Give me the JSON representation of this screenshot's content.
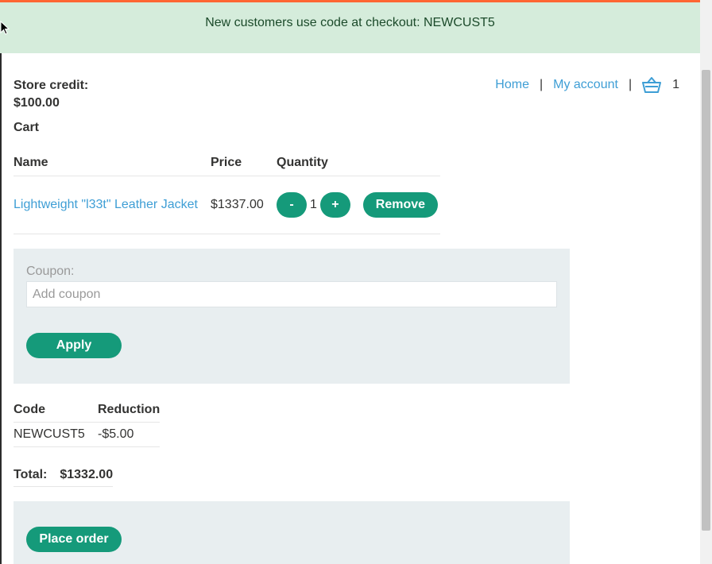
{
  "banner": {
    "text": "New customers use code at checkout: NEWCUST5"
  },
  "account": {
    "store_credit_label": "Store credit:",
    "store_credit_value": "$100.00"
  },
  "nav": {
    "home": "Home",
    "sep1": "|",
    "my_account": "My account",
    "sep2": "|",
    "cart_count": "1"
  },
  "cart": {
    "heading": "Cart",
    "columns": {
      "name": "Name",
      "price": "Price",
      "quantity": "Quantity"
    },
    "items": [
      {
        "name": "Lightweight \"l33t\" Leather Jacket",
        "price": "$1337.00",
        "quantity": "1",
        "minus": "-",
        "plus": "+",
        "remove": "Remove"
      }
    ]
  },
  "coupon": {
    "label": "Coupon:",
    "placeholder": "Add coupon",
    "apply": "Apply"
  },
  "applied_codes": {
    "columns": {
      "code": "Code",
      "reduction": "Reduction"
    },
    "rows": [
      {
        "code": "NEWCUST5",
        "reduction": "-$5.00"
      }
    ]
  },
  "total": {
    "label": "Total:",
    "value": "$1332.00"
  },
  "order": {
    "place_order": "Place order"
  },
  "colors": {
    "accent": "#159a7a",
    "link": "#3e9ed5",
    "banner_bg": "#d5ecdb",
    "top_bar": "#ff6633",
    "panel_bg": "#e8eef0"
  }
}
